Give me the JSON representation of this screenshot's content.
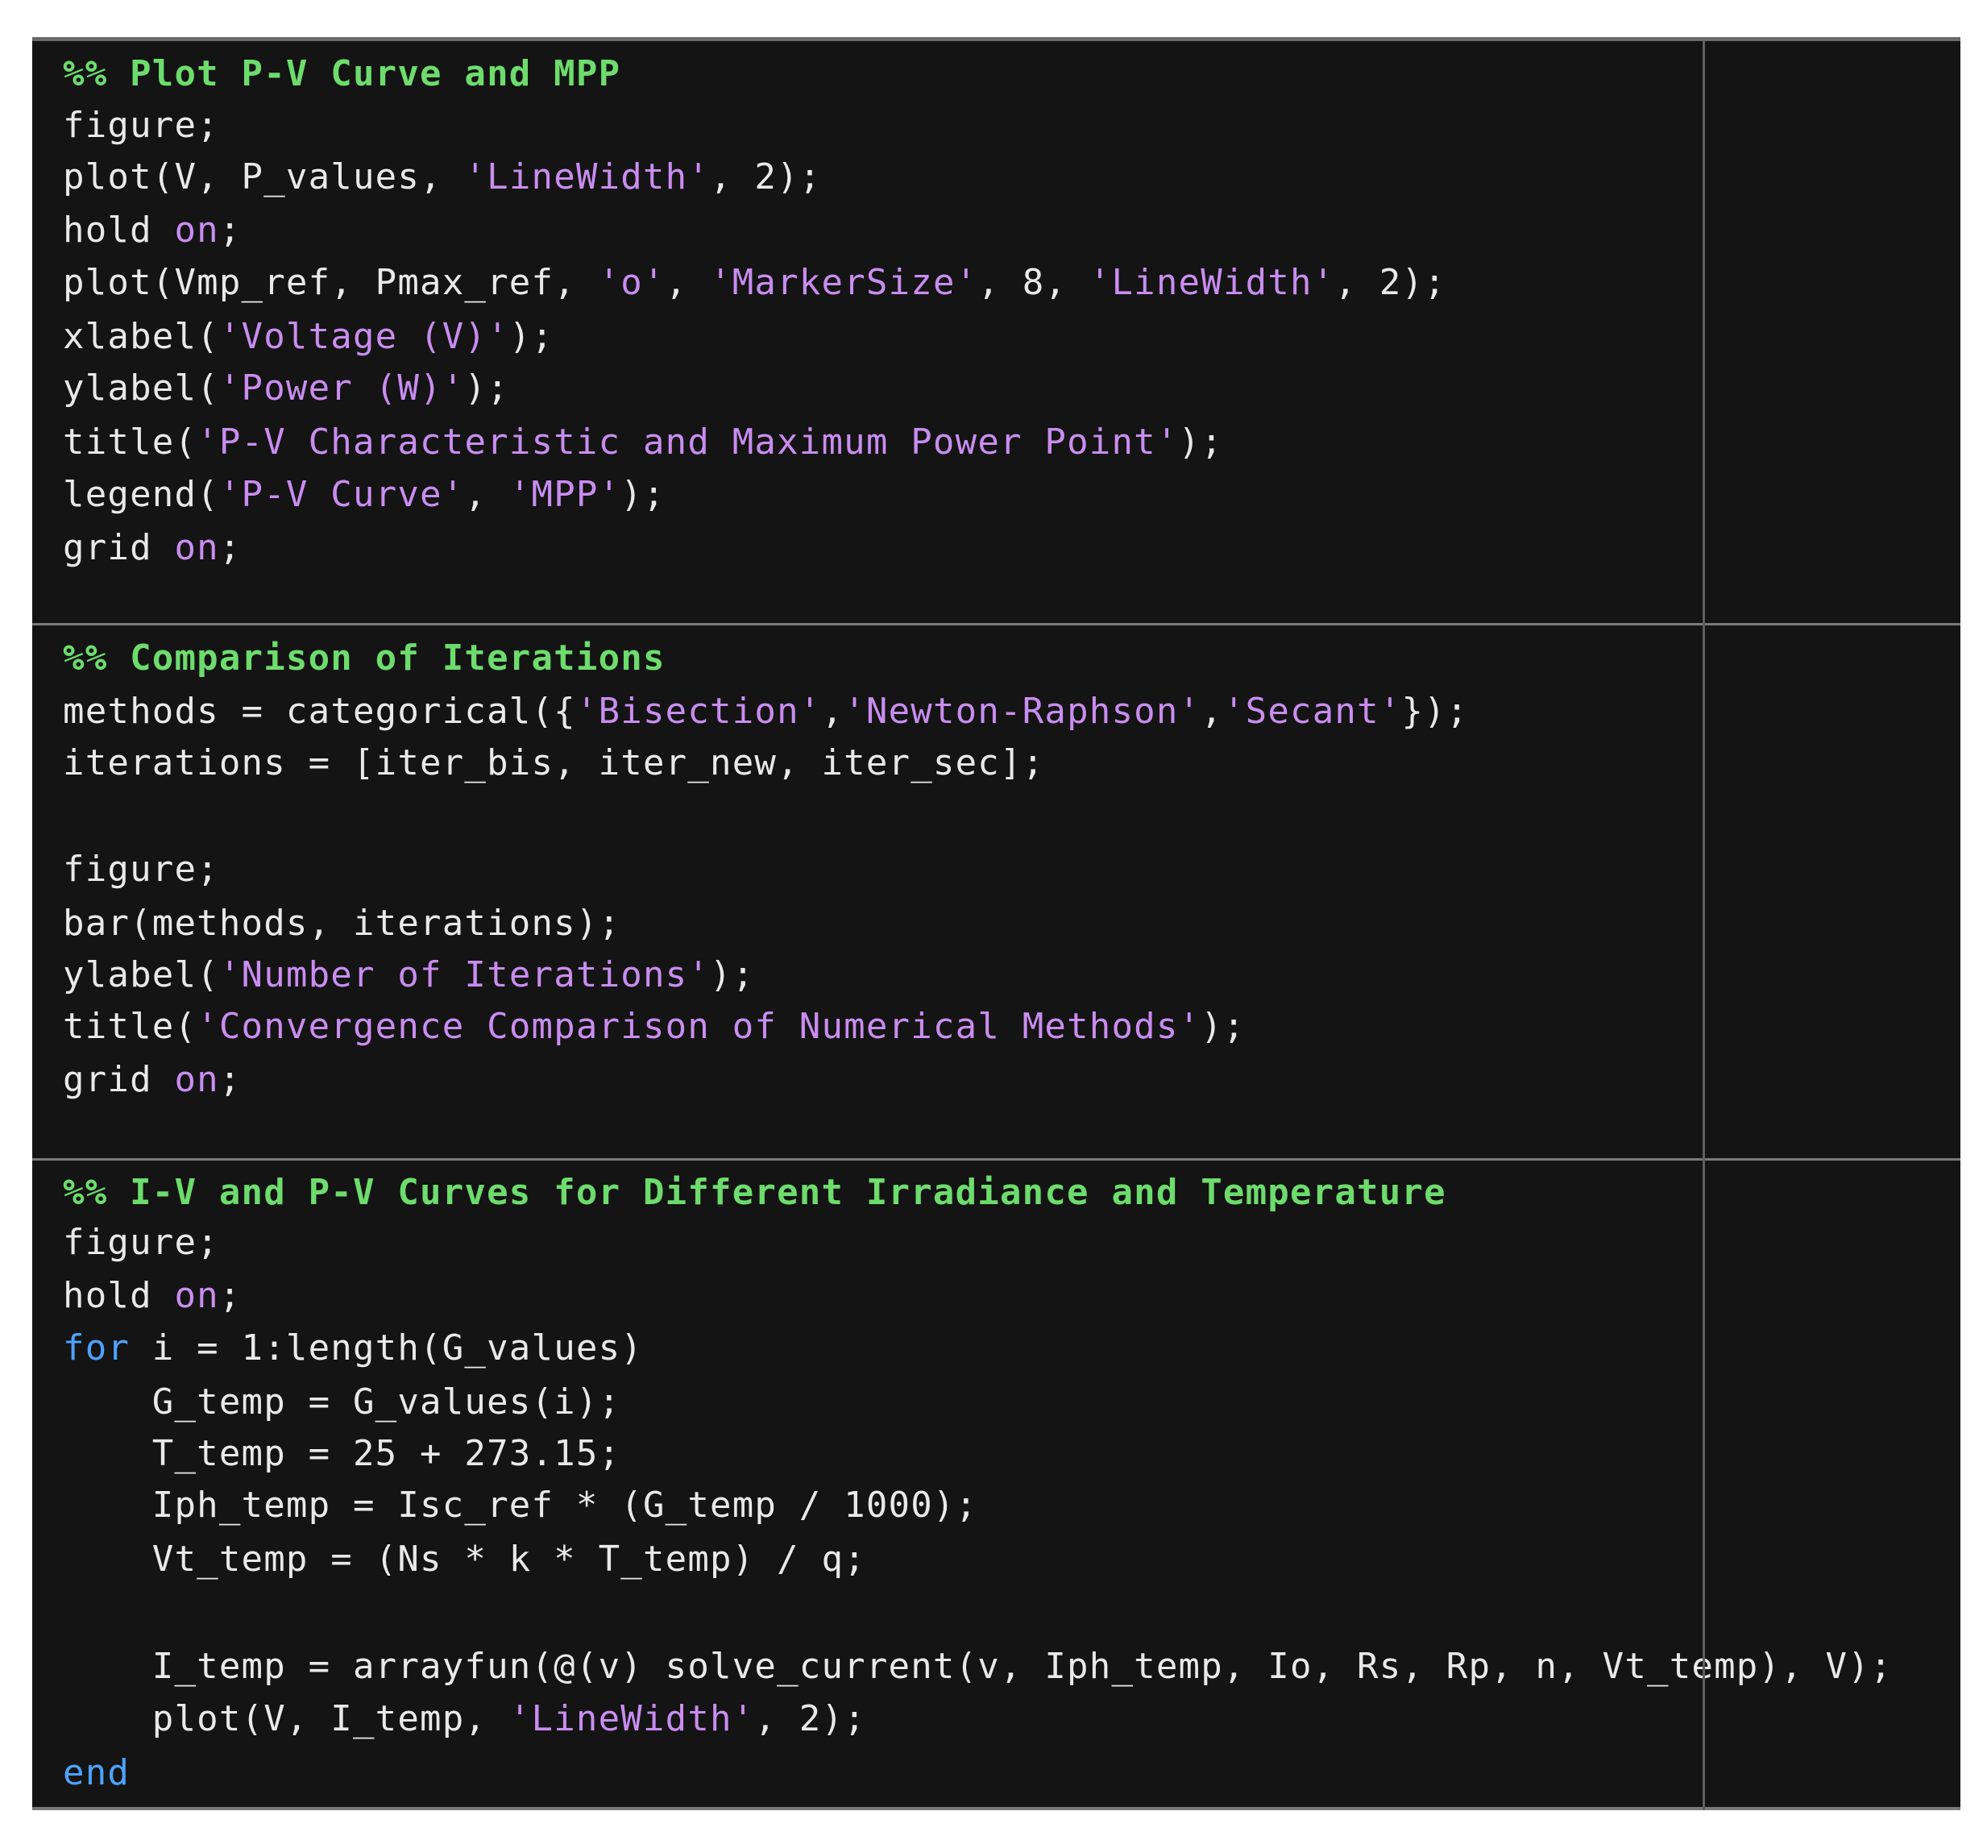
{
  "editor": {
    "sections": [
      {
        "name": "plot-pv-curve-section",
        "lines": [
          {
            "type": "comment",
            "text": "%% Plot P-V Curve and MPP"
          },
          {
            "type": "code",
            "tokens": [
              [
                "plain",
                "figure;"
              ]
            ]
          },
          {
            "type": "code",
            "tokens": [
              [
                "plain",
                "plot(V, P_values, "
              ],
              [
                "str",
                "'LineWidth'"
              ],
              [
                "plain",
                ", 2);"
              ]
            ]
          },
          {
            "type": "code",
            "tokens": [
              [
                "plain",
                "hold "
              ],
              [
                "on",
                "on"
              ],
              [
                "plain",
                ";"
              ]
            ]
          },
          {
            "type": "code",
            "tokens": [
              [
                "plain",
                "plot(Vmp_ref, Pmax_ref, "
              ],
              [
                "str",
                "'o'"
              ],
              [
                "plain",
                ", "
              ],
              [
                "str",
                "'MarkerSize'"
              ],
              [
                "plain",
                ", 8, "
              ],
              [
                "str",
                "'LineWidth'"
              ],
              [
                "plain",
                ", 2);"
              ]
            ]
          },
          {
            "type": "code",
            "tokens": [
              [
                "plain",
                "xlabel("
              ],
              [
                "str",
                "'Voltage (V)'"
              ],
              [
                "plain",
                ");"
              ]
            ]
          },
          {
            "type": "code",
            "tokens": [
              [
                "plain",
                "ylabel("
              ],
              [
                "str",
                "'Power (W)'"
              ],
              [
                "plain",
                ");"
              ]
            ]
          },
          {
            "type": "code",
            "tokens": [
              [
                "plain",
                "title("
              ],
              [
                "str",
                "'P-V Characteristic and Maximum Power Point'"
              ],
              [
                "plain",
                ");"
              ]
            ]
          },
          {
            "type": "code",
            "tokens": [
              [
                "plain",
                "legend("
              ],
              [
                "str",
                "'P-V Curve'"
              ],
              [
                "plain",
                ", "
              ],
              [
                "str",
                "'MPP'"
              ],
              [
                "plain",
                ");"
              ]
            ]
          },
          {
            "type": "code",
            "tokens": [
              [
                "plain",
                "grid "
              ],
              [
                "on",
                "on"
              ],
              [
                "plain",
                ";"
              ]
            ]
          }
        ]
      },
      {
        "name": "comparison-iterations-section",
        "lines": [
          {
            "type": "comment",
            "text": "%% Comparison of Iterations"
          },
          {
            "type": "code",
            "tokens": [
              [
                "plain",
                "methods = categorical({"
              ],
              [
                "str",
                "'Bisection'"
              ],
              [
                "plain",
                ","
              ],
              [
                "str",
                "'Newton-Raphson'"
              ],
              [
                "plain",
                ","
              ],
              [
                "str",
                "'Secant'"
              ],
              [
                "plain",
                "});"
              ]
            ]
          },
          {
            "type": "code",
            "tokens": [
              [
                "plain",
                "iterations = [iter_bis, iter_new, iter_sec];"
              ]
            ]
          },
          {
            "type": "code",
            "tokens": [
              [
                "plain",
                ""
              ]
            ]
          },
          {
            "type": "code",
            "tokens": [
              [
                "plain",
                "figure;"
              ]
            ]
          },
          {
            "type": "code",
            "tokens": [
              [
                "plain",
                "bar(methods, iterations);"
              ]
            ]
          },
          {
            "type": "code",
            "tokens": [
              [
                "plain",
                "ylabel("
              ],
              [
                "str",
                "'Number of Iterations'"
              ],
              [
                "plain",
                ");"
              ]
            ]
          },
          {
            "type": "code",
            "tokens": [
              [
                "plain",
                "title("
              ],
              [
                "str",
                "'Convergence Comparison of Numerical Methods'"
              ],
              [
                "plain",
                ");"
              ]
            ]
          },
          {
            "type": "code",
            "tokens": [
              [
                "plain",
                "grid "
              ],
              [
                "on",
                "on"
              ],
              [
                "plain",
                ";"
              ]
            ]
          }
        ]
      },
      {
        "name": "iv-pv-curves-section",
        "lines": [
          {
            "type": "comment",
            "text": "%% I-V and P-V Curves for Different Irradiance and Temperature"
          },
          {
            "type": "code",
            "tokens": [
              [
                "plain",
                "figure;"
              ]
            ]
          },
          {
            "type": "code",
            "tokens": [
              [
                "plain",
                "hold "
              ],
              [
                "on",
                "on"
              ],
              [
                "plain",
                ";"
              ]
            ]
          },
          {
            "type": "code",
            "tokens": [
              [
                "kw",
                "for"
              ],
              [
                "plain",
                " i = 1:length(G_values)"
              ]
            ]
          },
          {
            "type": "code",
            "tokens": [
              [
                "plain",
                "    G_temp = G_values(i);"
              ]
            ]
          },
          {
            "type": "code",
            "tokens": [
              [
                "plain",
                "    T_temp = 25 + 273.15;"
              ]
            ]
          },
          {
            "type": "code",
            "tokens": [
              [
                "plain",
                "    Iph_temp = Isc_ref * (G_temp / 1000);"
              ]
            ]
          },
          {
            "type": "code",
            "tokens": [
              [
                "plain",
                "    Vt_temp = (Ns * k * T_temp) / q;"
              ]
            ]
          },
          {
            "type": "code",
            "tokens": [
              [
                "plain",
                ""
              ]
            ]
          },
          {
            "type": "code",
            "tokens": [
              [
                "plain",
                "    I_temp = arrayfun(@(v) solve_current(v, Iph_temp, Io, Rs, Rp, n, Vt_temp), V);"
              ]
            ]
          },
          {
            "type": "code",
            "tokens": [
              [
                "plain",
                "    plot(V, I_temp, "
              ],
              [
                "str",
                "'LineWidth'"
              ],
              [
                "plain",
                ", 2);"
              ]
            ]
          },
          {
            "type": "code",
            "tokens": [
              [
                "kw",
                "end"
              ]
            ]
          }
        ]
      }
    ]
  }
}
